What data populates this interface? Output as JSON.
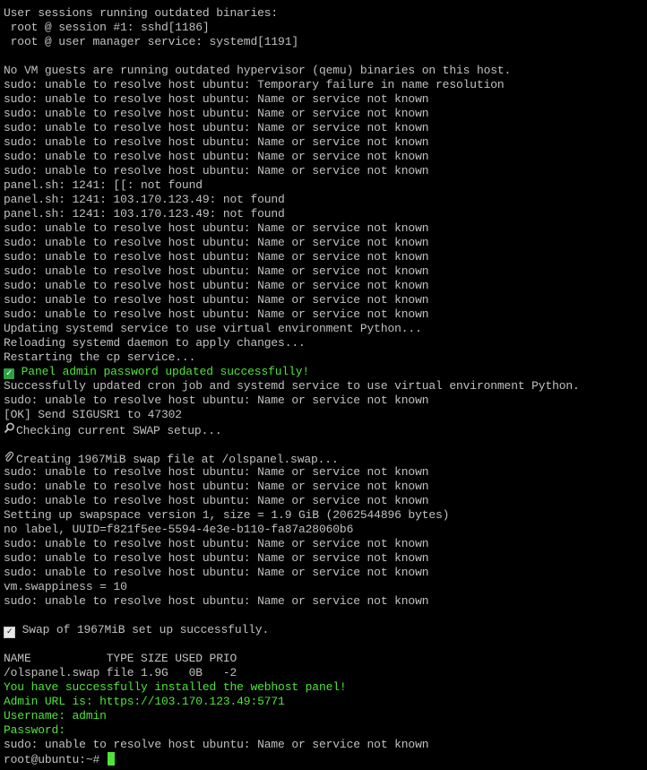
{
  "colors": {
    "background": "#000000",
    "text": "#c0c0c0",
    "success": "#4fe33b",
    "cursor": "#4fe33b"
  },
  "lines": [
    "User sessions running outdated binaries:",
    " root @ session #1: sshd[1186]",
    " root @ user manager service: systemd[1191]",
    "",
    "No VM guests are running outdated hypervisor (qemu) binaries on this host.",
    "sudo: unable to resolve host ubuntu: Temporary failure in name resolution",
    "sudo: unable to resolve host ubuntu: Name or service not known",
    "sudo: unable to resolve host ubuntu: Name or service not known",
    "sudo: unable to resolve host ubuntu: Name or service not known",
    "sudo: unable to resolve host ubuntu: Name or service not known",
    "sudo: unable to resolve host ubuntu: Name or service not known",
    "sudo: unable to resolve host ubuntu: Name or service not known",
    "panel.sh: 1241: [[: not found",
    "panel.sh: 1241: 103.170.123.49: not found",
    "panel.sh: 1241: 103.170.123.49: not found",
    "sudo: unable to resolve host ubuntu: Name or service not known",
    "sudo: unable to resolve host ubuntu: Name or service not known",
    "sudo: unable to resolve host ubuntu: Name or service not known",
    "sudo: unable to resolve host ubuntu: Name or service not known",
    "sudo: unable to resolve host ubuntu: Name or service not known",
    "sudo: unable to resolve host ubuntu: Name or service not known",
    "sudo: unable to resolve host ubuntu: Name or service not known",
    "Updating systemd service to use virtual environment Python...",
    "Reloading systemd daemon to apply changes...",
    "Restarting the cp service...",
    "Panel admin password updated successfully!",
    "Successfully updated cron job and systemd service to use virtual environment Python.",
    "sudo: unable to resolve host ubuntu: Name or service not known",
    "[OK] Send SIGUSR1 to 47302",
    "Checking current SWAP setup...",
    "",
    "Creating 1967MiB swap file at /olspanel.swap...",
    "sudo: unable to resolve host ubuntu: Name or service not known",
    "sudo: unable to resolve host ubuntu: Name or service not known",
    "sudo: unable to resolve host ubuntu: Name or service not known",
    "Setting up swapspace version 1, size = 1.9 GiB (2062544896 bytes)",
    "no label, UUID=f821f5ee-5594-4e3e-b110-fa87a28060b6",
    "sudo: unable to resolve host ubuntu: Name or service not known",
    "sudo: unable to resolve host ubuntu: Name or service not known",
    "sudo: unable to resolve host ubuntu: Name or service not known",
    "vm.swappiness = 10",
    "sudo: unable to resolve host ubuntu: Name or service not known",
    "",
    "Swap of 1967MiB set up successfully.",
    "",
    "NAME           TYPE SIZE USED PRIO",
    "/olspanel.swap file 1.9G   0B   -2",
    "You have successfully installed the webhost panel!",
    "Admin URL is: https://103.170.123.49:5771",
    "Username: admin",
    "Password:",
    "sudo: unable to resolve host ubuntu: Name or service not known",
    "root@ubuntu:~#"
  ],
  "icons": {
    "panel_password_icon": "check-mark-button-icon",
    "swap_check_icon": "magnifying-glass-icon",
    "swap_create_icon": "paperclip-icon",
    "swap_done_icon": "check-box-icon"
  }
}
